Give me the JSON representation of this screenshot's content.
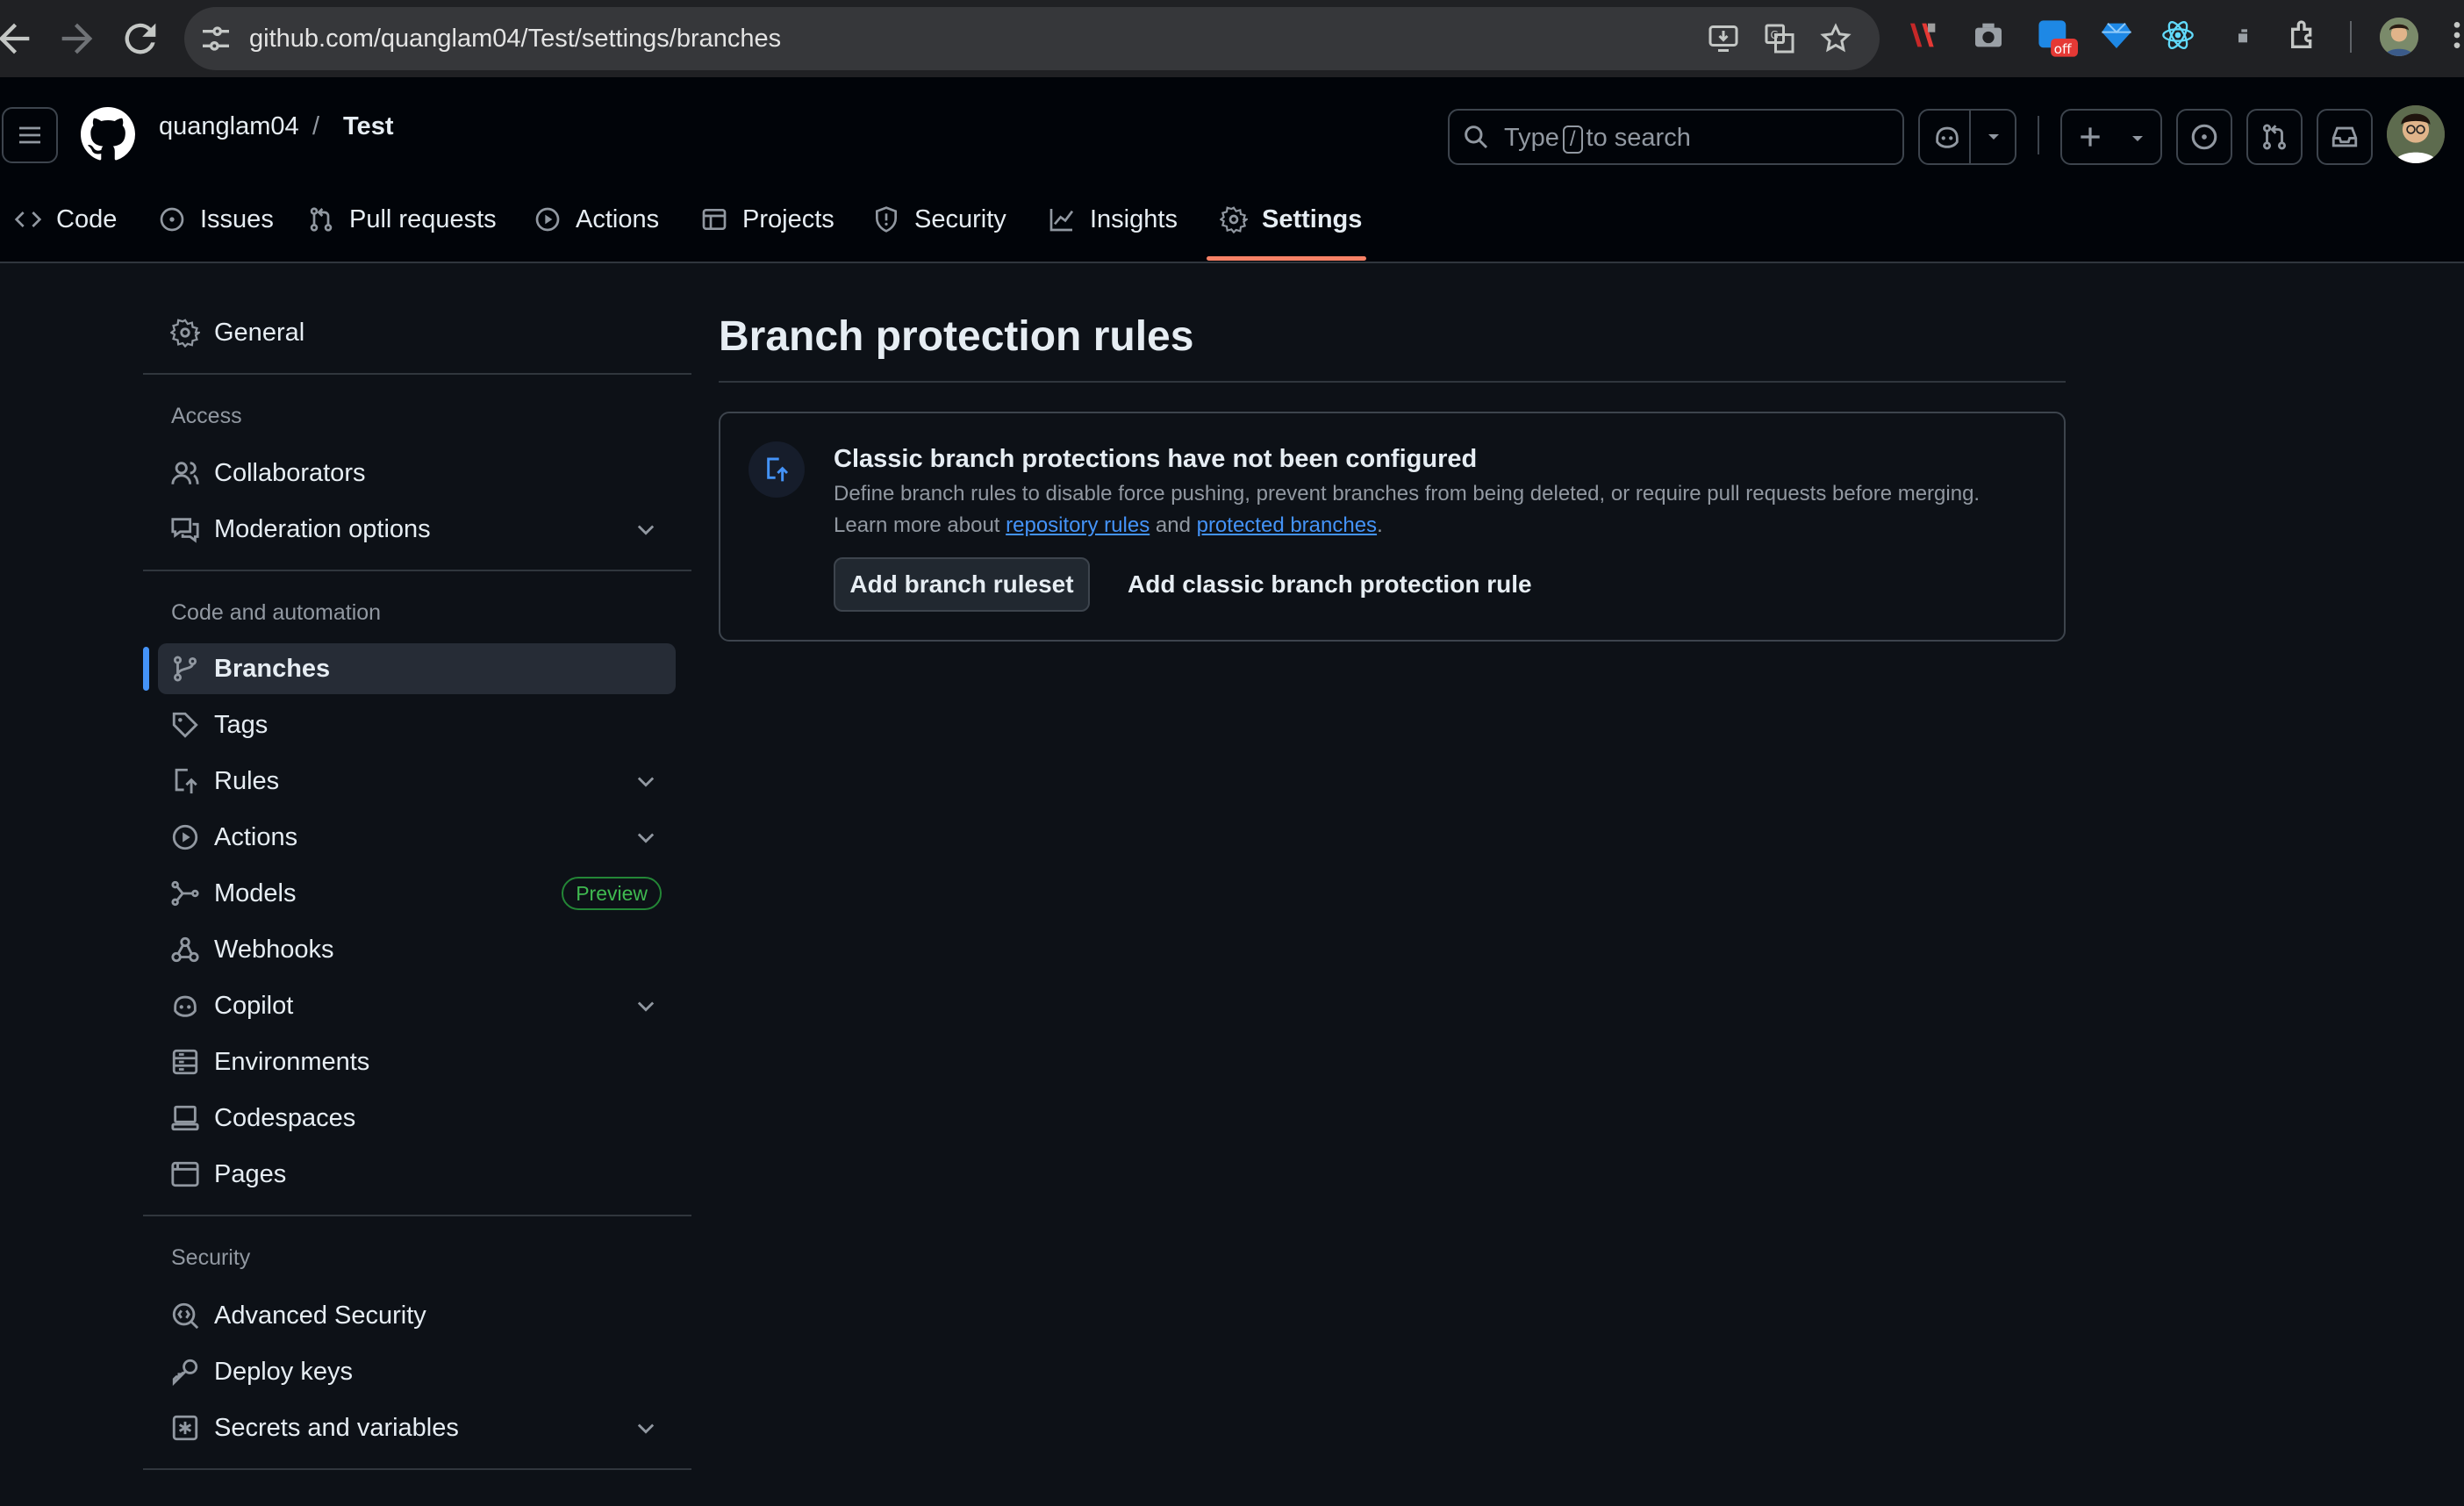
{
  "browser": {
    "url": "github.com/quanglam04/Test/settings/branches",
    "extension_badge": "off"
  },
  "header": {
    "owner": "quanglam04",
    "separator": "/",
    "repo": "Test",
    "search_prefix": "Type",
    "search_key": "/",
    "search_suffix": "to search"
  },
  "tabs": [
    {
      "label": "Code",
      "icon": "code-icon"
    },
    {
      "label": "Issues",
      "icon": "issue-opened-icon"
    },
    {
      "label": "Pull requests",
      "icon": "git-pull-request-icon"
    },
    {
      "label": "Actions",
      "icon": "play-icon"
    },
    {
      "label": "Projects",
      "icon": "table-icon"
    },
    {
      "label": "Security",
      "icon": "shield-icon"
    },
    {
      "label": "Insights",
      "icon": "graph-icon"
    },
    {
      "label": "Settings",
      "icon": "gear-icon",
      "active": true
    }
  ],
  "sidebar": {
    "general": "General",
    "access_heading": "Access",
    "collaborators": "Collaborators",
    "moderation": "Moderation options",
    "code_heading": "Code and automation",
    "branches": "Branches",
    "tags": "Tags",
    "rules": "Rules",
    "actions": "Actions",
    "models": "Models",
    "models_badge": "Preview",
    "webhooks": "Webhooks",
    "copilot": "Copilot",
    "environments": "Environments",
    "codespaces": "Codespaces",
    "pages": "Pages",
    "security_heading": "Security",
    "advanced_security": "Advanced Security",
    "deploy_keys": "Deploy keys",
    "secrets": "Secrets and variables"
  },
  "main": {
    "title": "Branch protection rules",
    "blankslate_heading": "Classic branch protections have not been configured",
    "blankslate_desc": "Define branch rules to disable force pushing, prevent branches from being deleted, or require pull requests before merging.",
    "learn_prefix": "Learn more about",
    "link_repo_rules": "repository rules",
    "learn_and": "and",
    "link_protected": "protected branches",
    "learn_suffix": ".",
    "add_ruleset": "Add branch ruleset",
    "add_classic": "Add classic branch protection rule"
  },
  "colors": {
    "background": "#0d1117",
    "header": "#010409",
    "accent_blue": "#4493f8",
    "tab_underline": "#f78166",
    "badge_green": "#3fb950"
  }
}
